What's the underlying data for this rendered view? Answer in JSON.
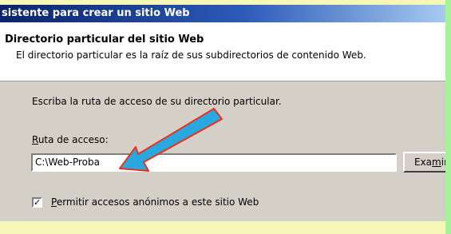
{
  "window": {
    "title": "sistente para crear un sitio Web"
  },
  "header": {
    "title": "Directorio particular del sitio Web",
    "subtitle": "El directorio particular es la raíz de sus subdirectorios de contenido Web."
  },
  "form": {
    "instruction": "Escriba la ruta de acceso de su directorio particular.",
    "path_label_first": "R",
    "path_label_rest": "uta de acceso:",
    "path_value": "C:\\Web-Proba",
    "browse_label_pre": "Exa",
    "browse_label_ul": "m",
    "browse_label_post": "ir",
    "checkbox_checked": true,
    "checkbox_mark": "✓",
    "checkbox_label_first": "P",
    "checkbox_label_rest": "ermitir accesos anónimos a este sitio Web"
  },
  "annotation": {
    "arrow_color": "#29a8e0"
  }
}
